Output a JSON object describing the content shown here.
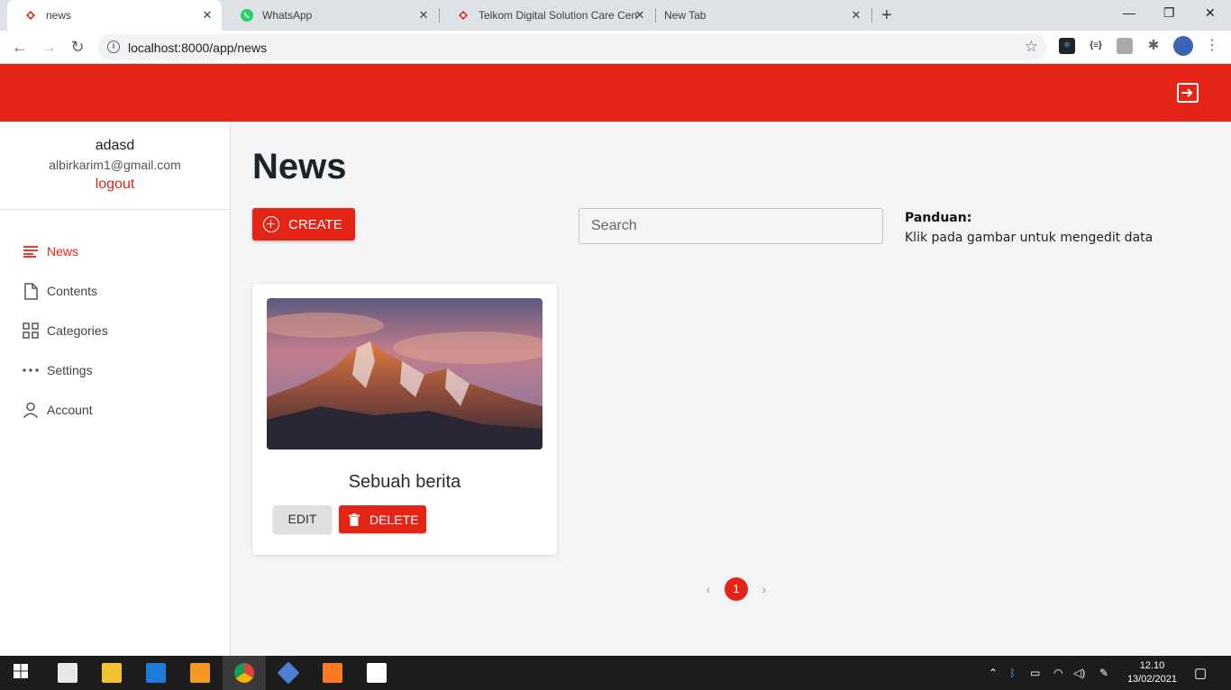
{
  "browser": {
    "tabs": [
      {
        "title": "news",
        "active": true
      },
      {
        "title": "WhatsApp",
        "active": false
      },
      {
        "title": "Telkom Digital Solution Care Cen",
        "active": false
      },
      {
        "title": "New Tab",
        "active": false
      }
    ],
    "url": "localhost:8000/app/news"
  },
  "colors": {
    "accent": "#e32416",
    "background": "#f3f4f6"
  },
  "sidebar": {
    "user_name": "adasd",
    "user_email": "albirkarim1@gmail.com",
    "logout_label": "logout",
    "items": [
      {
        "label": "News",
        "icon": "lines-icon",
        "active": true
      },
      {
        "label": "Contents",
        "icon": "document-icon",
        "active": false
      },
      {
        "label": "Categories",
        "icon": "grid-icon",
        "active": false
      },
      {
        "label": "Settings",
        "icon": "dots-icon",
        "active": false
      },
      {
        "label": "Account",
        "icon": "person-icon",
        "active": false
      }
    ]
  },
  "main": {
    "title": "News",
    "create_label": "CREATE",
    "search_placeholder": "Search",
    "guide_title": "Panduan:",
    "guide_text": "Klik pada gambar untuk mengedit data",
    "cards": [
      {
        "title": "Sebuah berita",
        "edit_label": "EDIT",
        "delete_label": "DELETE"
      }
    ],
    "pagination": {
      "current_page": "1"
    }
  },
  "taskbar": {
    "time": "12.10",
    "date": "13/02/2021"
  }
}
